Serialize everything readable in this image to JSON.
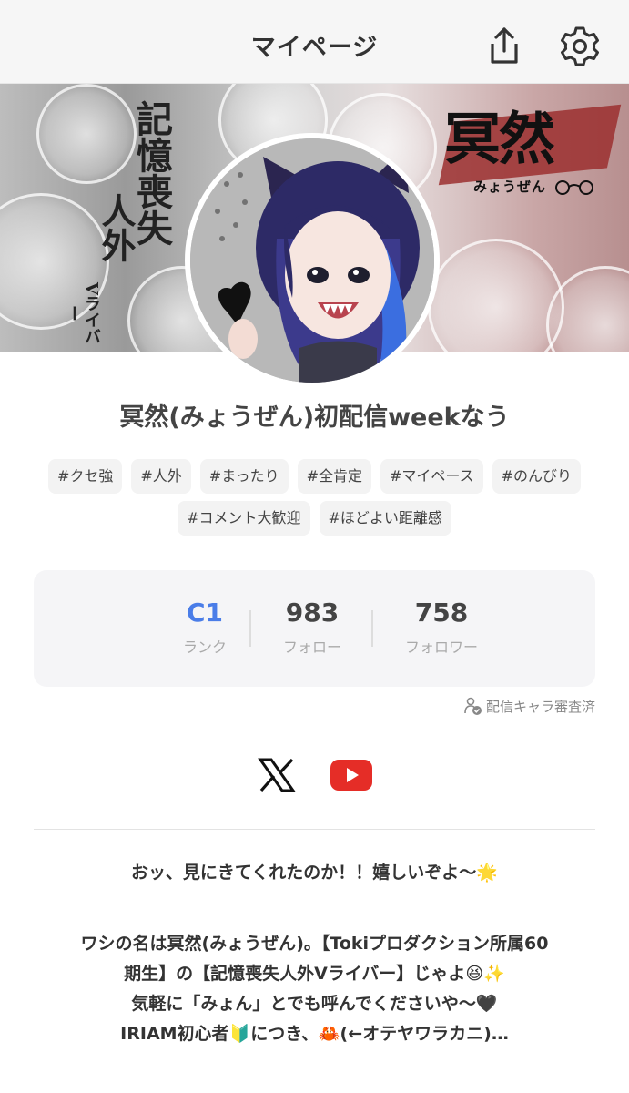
{
  "header": {
    "title": "マイページ"
  },
  "banner": {
    "vertical_text_1": "記憶",
    "vertical_text_2": "喪失",
    "vertical_text_3": "人外",
    "vertical_text_4": "Vライバー",
    "logo_kanji": "冥然",
    "logo_kana": "みょうぜん"
  },
  "profile": {
    "name": "冥然(みょうぜん)初配信weekなう"
  },
  "tags": {
    "row1": [
      "#クセ強",
      "#人外",
      "#まったり",
      "#全肯定",
      "#マイペース",
      "#のんびり"
    ],
    "row2": [
      "#コメント大歓迎",
      "#ほどよい距離感"
    ]
  },
  "stats": {
    "rank": {
      "value": "C1",
      "label": "ランク"
    },
    "follow": {
      "value": "983",
      "label": "フォロー"
    },
    "followers": {
      "value": "758",
      "label": "フォロワー"
    }
  },
  "verified_text": "配信キャラ審査済",
  "social": {
    "x_icon": "x-logo-icon",
    "youtube_icon": "youtube-icon"
  },
  "bio": {
    "line1": "おッ、見にきてくれたのか！！嬉しいぞよ〜🌟",
    "line2": "ワシの名は冥然(みょうぜん)。【Tokiプロダクション所属60",
    "line3": "期生】の【記憶喪失人外Vライバー】じゃよ😆✨",
    "line4": "気軽に「みょん」とでも呼んでくださいや〜🖤",
    "line5": "IRIAM初心者🔰につき、🦀(←オテヤワラカニ)…"
  },
  "colors": {
    "accent_blue": "#4a7de8",
    "youtube_red": "#e52d27",
    "logo_red": "#9b2f2f"
  }
}
